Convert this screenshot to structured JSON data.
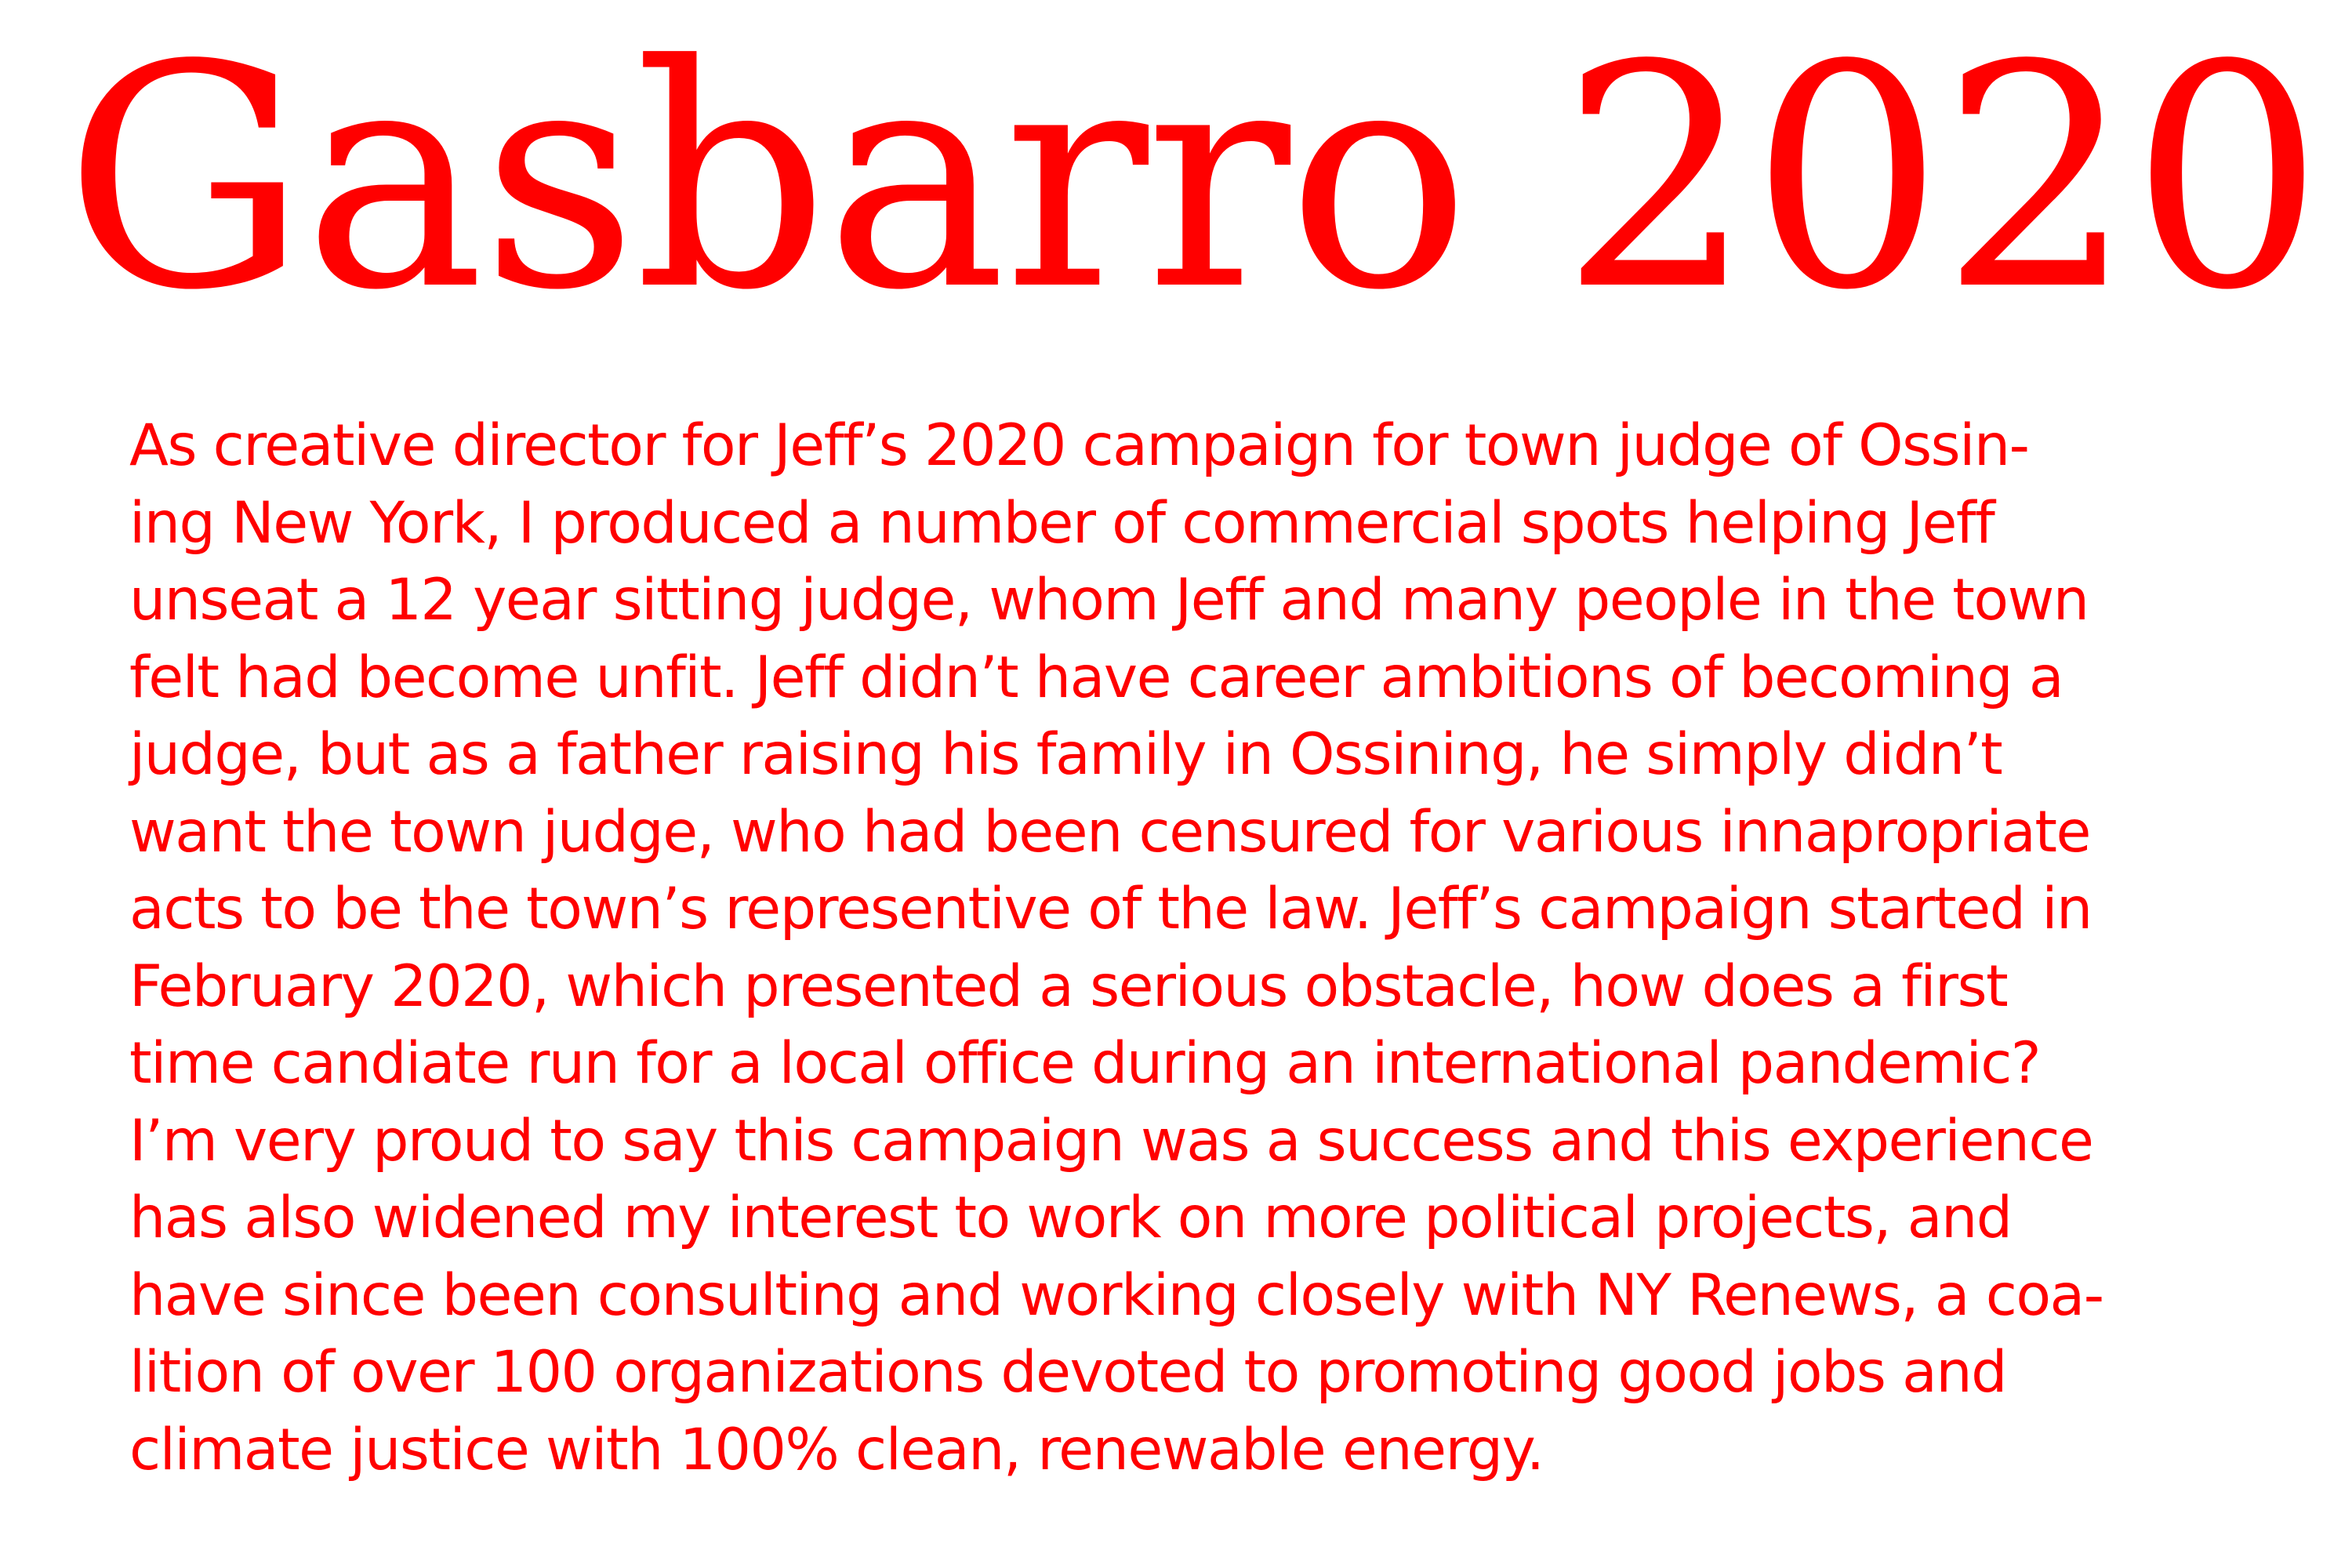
{
  "theme": {
    "text_color": "#ff0000",
    "background_color": "#ffffff"
  },
  "title": "Gasbarro 2020",
  "body_lines": [
    "As creative director for Jeff’s 2020 campaign for town judge of Ossin-",
    "ing New York, I produced a number of commercial spots helping Jeff",
    "unseat a 12 year sitting judge, whom Jeff and many people in the town",
    "felt had become unfit. Jeff didn’t have career ambitions of becoming a",
    "judge, but as a father raising his family in Ossining, he simply didn’t",
    "want the town judge, who had been censured for various innapropriate",
    "acts to be the town’s representive of the law. Jeff’s campaign started in",
    "February 2020, which presented a serious obstacle, how does a first",
    "time candiate run for a local office during an international pandemic?",
    "I’m very proud to say this campaign was a success and this experience",
    "has also widened my interest to work on more political projects, and",
    "have since been consulting and working closely with NY Renews, a coa-",
    "lition of over 100 organizations devoted to promoting good jobs and",
    "climate justice with 100% clean, renewable energy."
  ]
}
